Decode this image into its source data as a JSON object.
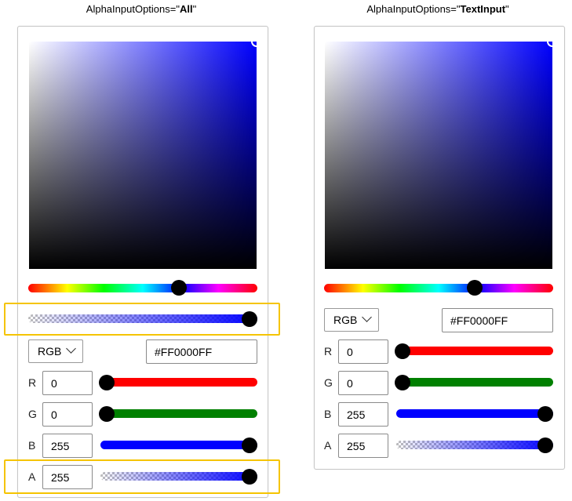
{
  "captions": {
    "left_prefix": "AlphaInputOptions=\"",
    "left_bold": "All",
    "left_suffix": "\"",
    "right_prefix": "AlphaInputOptions=\"",
    "right_bold": "TextInput",
    "right_suffix": "\""
  },
  "left_picker": {
    "color_model": "RGB",
    "hex_value": "#FF0000FF",
    "channels": [
      {
        "label": "R",
        "value": "0",
        "level": 0
      },
      {
        "label": "G",
        "value": "0",
        "level": 0
      },
      {
        "label": "B",
        "value": "255",
        "level": 1
      },
      {
        "label": "A",
        "value": "255",
        "level": 1
      }
    ],
    "hue_level": 0.667,
    "alpha_level": 1
  },
  "right_picker": {
    "color_model": "RGB",
    "hex_value": "#FF0000FF",
    "channels": [
      {
        "label": "R",
        "value": "0",
        "level": 0
      },
      {
        "label": "G",
        "value": "0",
        "level": 0
      },
      {
        "label": "B",
        "value": "255",
        "level": 1
      },
      {
        "label": "A",
        "value": "255",
        "level": 1
      }
    ],
    "hue_level": 0.667
  },
  "colors": {
    "highlight": "#f5c400",
    "selected_color": "#0000ff"
  }
}
